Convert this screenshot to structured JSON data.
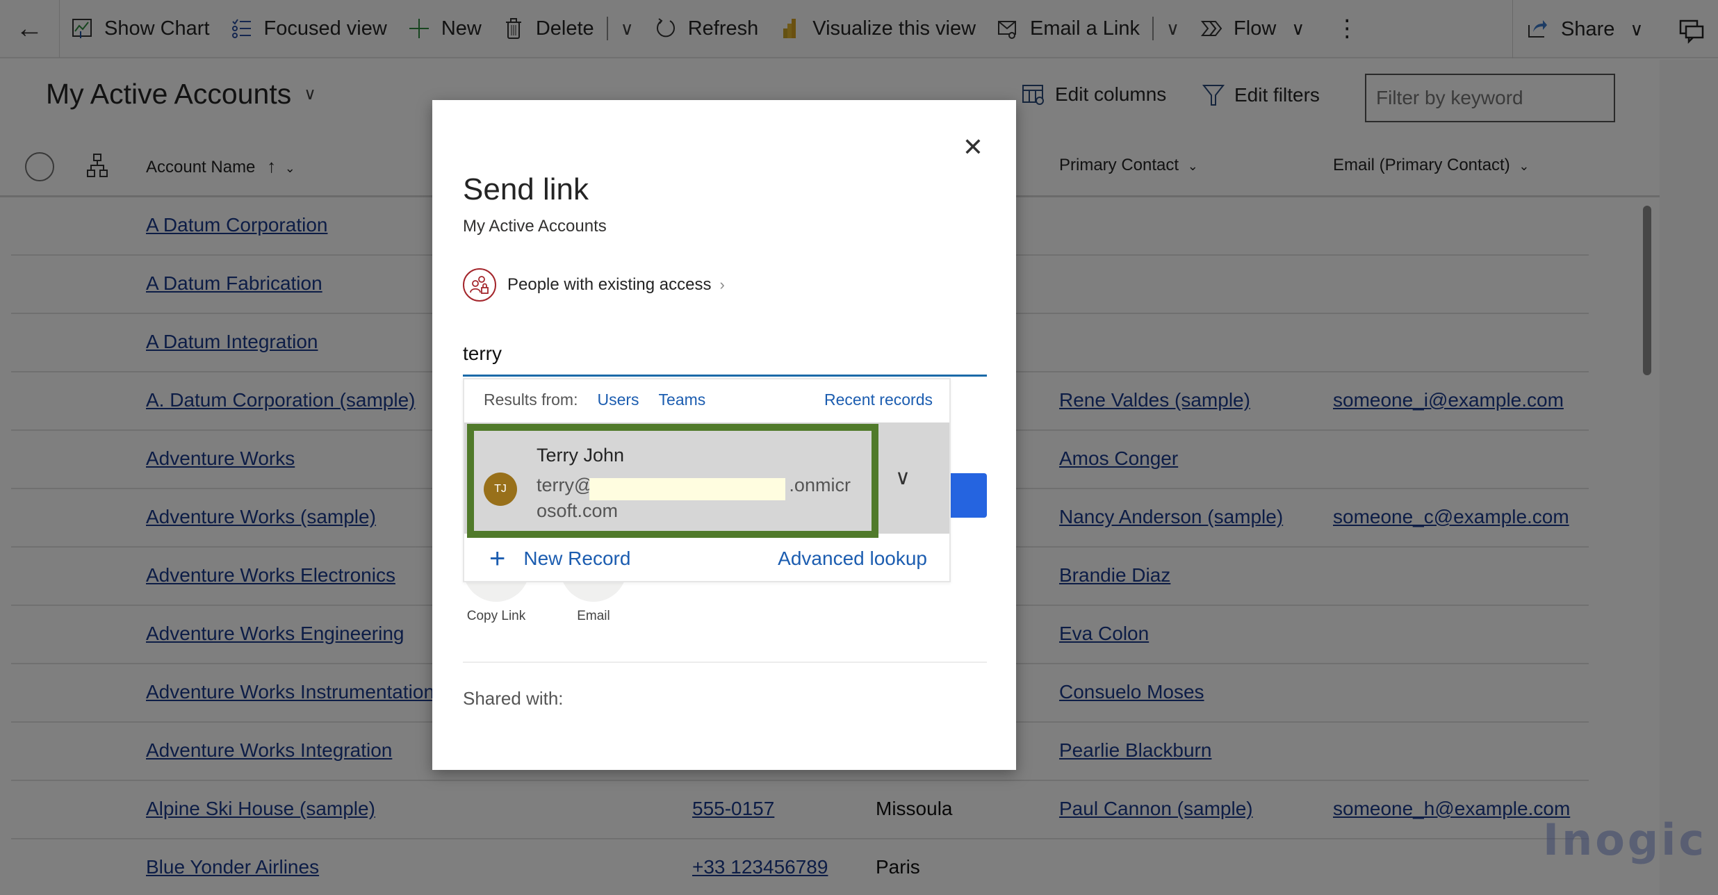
{
  "toolbar": {
    "back_label": "←",
    "items": [
      {
        "label": "Show Chart",
        "icon": "chart-icon"
      },
      {
        "label": "Focused view",
        "icon": "focused-list-icon"
      },
      {
        "label": "New",
        "icon": "plus-icon"
      },
      {
        "label": "Delete",
        "icon": "trash-icon"
      },
      {
        "label": "Refresh",
        "icon": "refresh-icon"
      },
      {
        "label": "Visualize this view",
        "icon": "powerbi-icon"
      },
      {
        "label": "Email a Link",
        "icon": "email-link-icon"
      },
      {
        "label": "Flow",
        "icon": "flow-icon"
      }
    ],
    "share_label": "Share",
    "more_label": "⋮",
    "chevron": "∨"
  },
  "view": {
    "title": "My Active Accounts",
    "title_chevron": "∨",
    "edit_columns": "Edit columns",
    "edit_filters": "Edit filters",
    "filter_placeholder": "Filter by keyword"
  },
  "grid": {
    "columns": [
      {
        "label": "Account Name",
        "sort": "↑",
        "chevron": "⌄"
      },
      {
        "label": "Primary Contact",
        "chevron": "⌄"
      },
      {
        "label": "Email (Primary Contact)",
        "chevron": "⌄"
      }
    ],
    "rows": [
      {
        "name": "A Datum Corporation",
        "phone": "",
        "city": "",
        "contact": "",
        "email": ""
      },
      {
        "name": "A Datum Fabrication",
        "phone": "",
        "city": "",
        "contact": "",
        "email": ""
      },
      {
        "name": "A Datum Integration",
        "phone": "",
        "city": "",
        "contact": "",
        "email": ""
      },
      {
        "name": "A. Datum Corporation (sample)",
        "phone": "",
        "city": "",
        "contact": "Rene Valdes (sample)",
        "email": "someone_i@example.com"
      },
      {
        "name": "Adventure Works",
        "phone": "",
        "city": "",
        "contact": "Amos Conger",
        "email": ""
      },
      {
        "name": "Adventure Works (sample)",
        "phone": "",
        "city": "",
        "contact": "Nancy Anderson (sample)",
        "email": "someone_c@example.com"
      },
      {
        "name": "Adventure Works Electronics",
        "phone": "",
        "city": "",
        "contact": "Brandie Diaz",
        "email": ""
      },
      {
        "name": "Adventure Works Engineering",
        "phone": "",
        "city": "",
        "contact": "Eva Colon",
        "email": ""
      },
      {
        "name": "Adventure Works Instrumentation",
        "phone": "",
        "city": "",
        "contact": "Consuelo Moses",
        "email": ""
      },
      {
        "name": "Adventure Works Integration",
        "phone": "",
        "city": "",
        "contact": "Pearlie Blackburn",
        "email": ""
      },
      {
        "name": "Alpine Ski House (sample)",
        "phone": "555-0157",
        "city": "Missoula",
        "contact": "Paul Cannon (sample)",
        "email": "someone_h@example.com"
      },
      {
        "name": "Blue Yonder Airlines",
        "phone": "+33 123456789",
        "city": "Paris",
        "contact": "",
        "email": ""
      }
    ]
  },
  "dialog": {
    "close_label": "✕",
    "title": "Send link",
    "subtitle": "My Active Accounts",
    "access_label": "People with existing access",
    "access_chevron": "›",
    "search_value": "terry",
    "dropdown": {
      "results_from": "Results from:",
      "tabs": [
        "Users",
        "Teams"
      ],
      "recent": "Recent records",
      "result": {
        "initials": "TJ",
        "name": "Terry John",
        "email_prefix": "terry@",
        "email_suffix": ".onmicrosoft.com"
      },
      "expand_label": "∨",
      "new_record": "New Record",
      "advanced_lookup": "Advanced lookup"
    },
    "actions": [
      {
        "label": "Copy Link",
        "icon": "copy-link-icon"
      },
      {
        "label": "Email",
        "icon": "email-icon"
      }
    ],
    "shared_with": "Shared with:"
  },
  "watermark": "Inogic",
  "colors": {
    "link": "#1b3a8c",
    "accent_blue": "#2564e0",
    "highlight_green": "#507a2a",
    "avatar": "#98701a",
    "access_red": "#a4262c"
  }
}
